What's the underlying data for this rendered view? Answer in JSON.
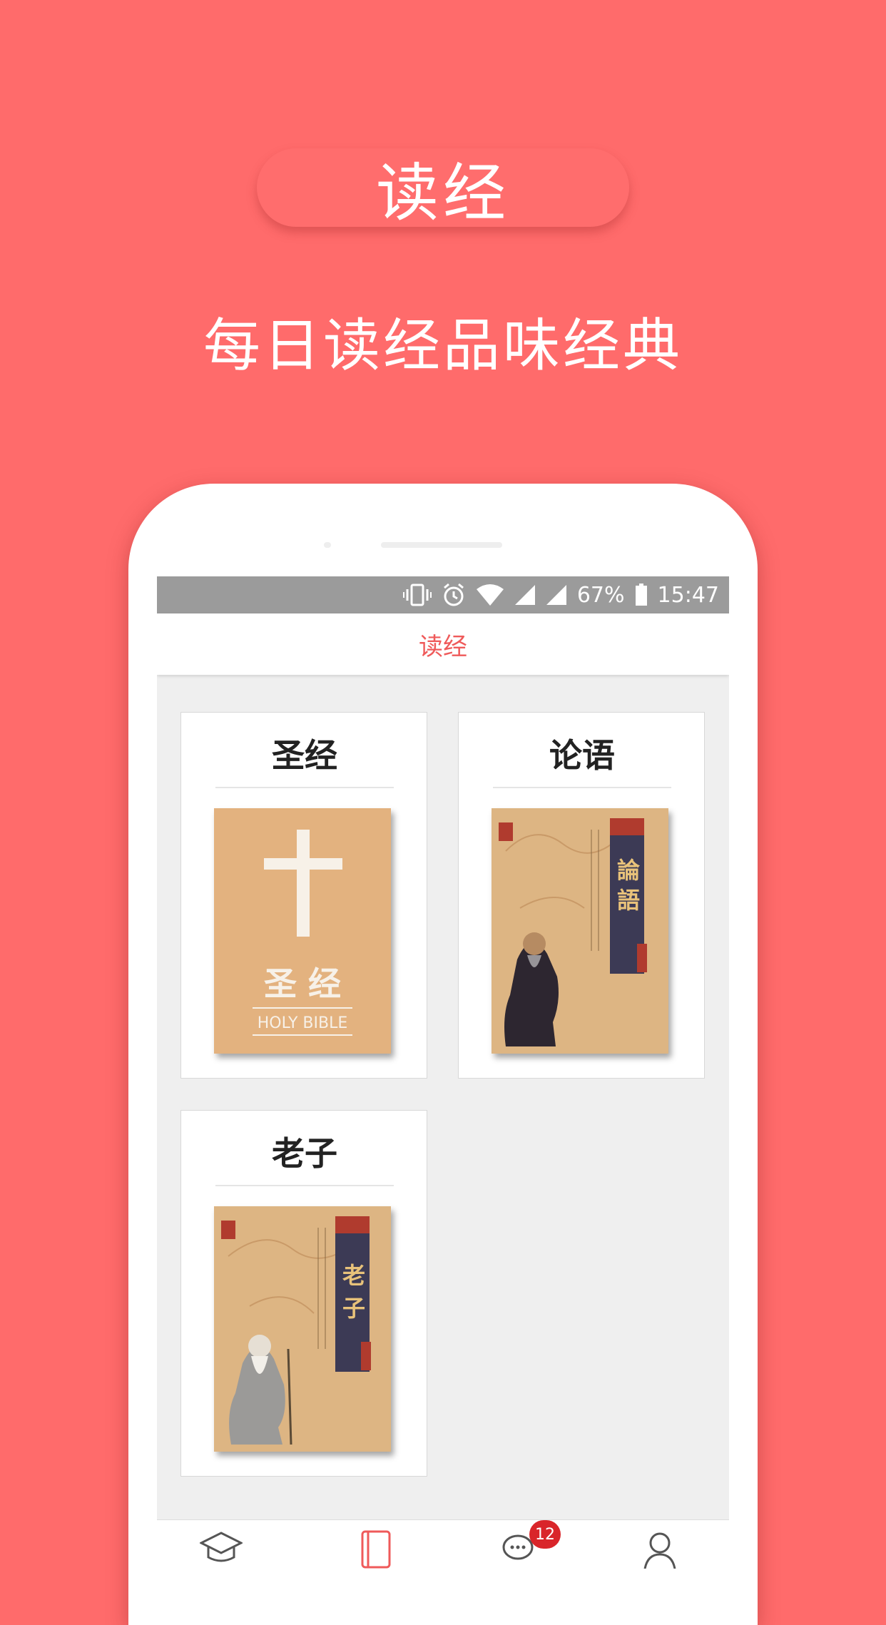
{
  "promo": {
    "pill_title": "读经",
    "subtitle": "每日读经品味经典"
  },
  "status_bar": {
    "battery": "67%",
    "time": "15:47",
    "icons": [
      "vibrate-icon",
      "alarm-icon",
      "wifi-icon",
      "signal-icon",
      "signal-icon",
      "battery-icon"
    ]
  },
  "app": {
    "title": "读经"
  },
  "books": [
    {
      "title": "圣经",
      "cover_text": "圣 经",
      "cover_subtext": "HOLY BIBLE"
    },
    {
      "title": "论语",
      "cover_text": "論語"
    },
    {
      "title": "老子",
      "cover_text": "老子"
    }
  ],
  "bottom_nav": {
    "items": [
      {
        "icon": "graduation-cap-icon"
      },
      {
        "icon": "book-icon",
        "active": true
      },
      {
        "icon": "chat-bubble-icon",
        "badge": "12"
      },
      {
        "icon": "user-icon"
      }
    ]
  },
  "colors": {
    "background": "#ff6b6b",
    "accent": "#ef5a5a",
    "badge": "#d9252a"
  }
}
